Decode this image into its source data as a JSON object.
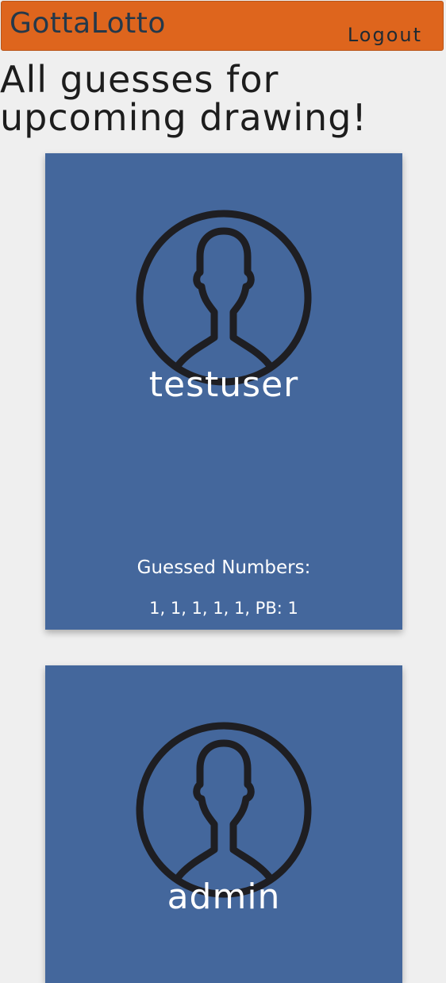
{
  "navbar": {
    "brand": "GottaLotto",
    "logout_label": "Logout",
    "background_color": "#de651d"
  },
  "page": {
    "title_line1": "All guesses for",
    "title_line2": "upcoming drawing!"
  },
  "cards": [
    {
      "avatar_icon": "user-silhouette-icon",
      "username": "testuser",
      "guessed_label": "Guessed Numbers:",
      "guessed_values": "1, 1, 1, 1, 1, PB: 1"
    },
    {
      "avatar_icon": "user-silhouette-icon",
      "username": "admin"
    }
  ],
  "colors": {
    "card_background": "#44679c",
    "page_background": "#efefef"
  }
}
